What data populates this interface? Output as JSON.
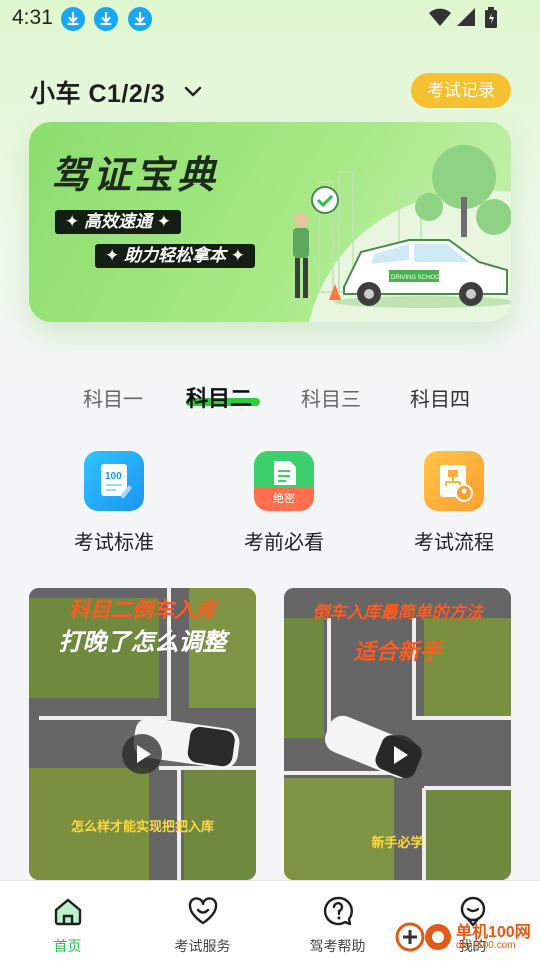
{
  "status_bar": {
    "time": "4:31"
  },
  "header": {
    "vehicle_label": "小车 C1/2/3",
    "record_button": "考试记录"
  },
  "banner": {
    "title": "驾证宝典",
    "tag1": "✦ 高效速通 ✦",
    "tag2": "✦ 助力轻松拿本 ✦",
    "sign_text": "DRIVING SCHOOL"
  },
  "subject_tabs": [
    "科目一",
    "科目二",
    "科目三",
    "科目四"
  ],
  "active_subject_index": 1,
  "quick_entries": [
    {
      "label": "考试标准",
      "icon": "exam-standard-icon",
      "badge": "100"
    },
    {
      "label": "考前必看",
      "icon": "must-read-icon",
      "badge": "绝密"
    },
    {
      "label": "考试流程",
      "icon": "exam-flow-icon"
    }
  ],
  "video_cards": [
    {
      "title_line1": "科目二倒车入库",
      "title_line2": "打晚了怎么调整",
      "subtitle": "怎么样才能实现把把入库"
    },
    {
      "title_line1": "倒车入库最简单的方法",
      "title_line2": "适合新手",
      "subtitle": "新手必学"
    }
  ],
  "bottom_nav": [
    {
      "label": "首页",
      "icon": "home-icon",
      "active": true
    },
    {
      "label": "考试服务",
      "icon": "heart-service-icon",
      "active": false
    },
    {
      "label": "驾考帮助",
      "icon": "help-icon",
      "active": false
    },
    {
      "label": "我的",
      "icon": "profile-icon",
      "active": false
    }
  ],
  "watermark": {
    "brand": "单机100网",
    "url": "danji100.com"
  },
  "colors": {
    "accent_green": "#2ebd4e",
    "record_yellow": "#f6c131",
    "download_blue": "#1aa7f1"
  }
}
